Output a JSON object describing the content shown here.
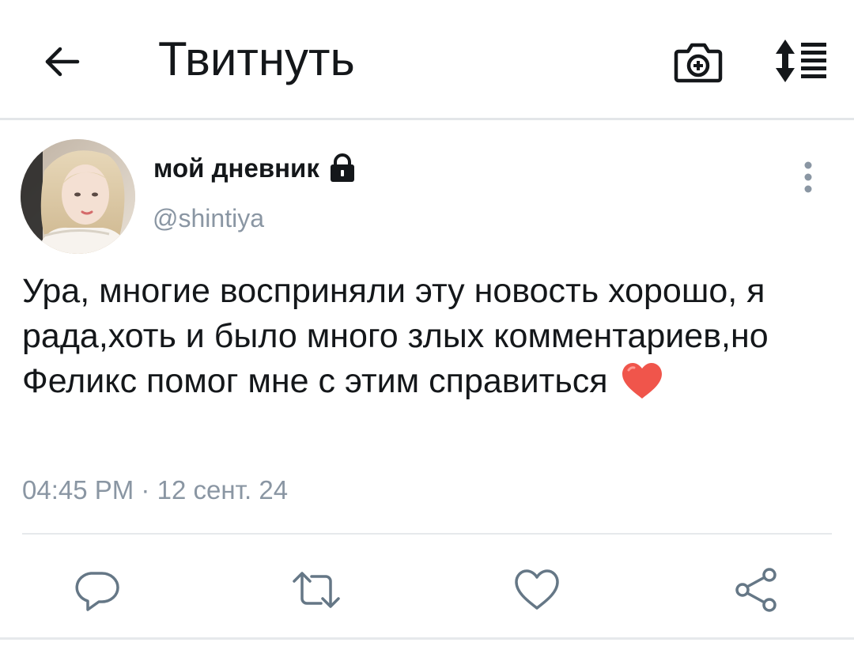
{
  "header": {
    "title": "Твитнуть",
    "icons": {
      "back": "arrow-left-icon",
      "camera": "camera-plus-icon",
      "sort": "sort-list-icon"
    }
  },
  "tweet": {
    "display_name": "мой дневник",
    "protected_icon": "lock-icon",
    "handle": "@shintiya",
    "text": "Ура, многие восприняли эту новость хорошо, я рада,хоть и было много злых комментариев,но Феликс помог мне с этим справиться",
    "emoji": "❤️",
    "time": "04:45 PM",
    "separator": "·",
    "date": "12 сент. 24",
    "more_icon": "more-vertical-icon"
  },
  "actions": [
    {
      "name": "reply",
      "icon": "reply-icon"
    },
    {
      "name": "retweet",
      "icon": "retweet-icon"
    },
    {
      "name": "like",
      "icon": "heart-icon"
    },
    {
      "name": "share",
      "icon": "share-icon"
    }
  ],
  "colors": {
    "text": "#14171a",
    "secondary": "#8a96a3",
    "icon": "#657786",
    "divider": "#e6e9ec",
    "heart": "#f0554b"
  }
}
